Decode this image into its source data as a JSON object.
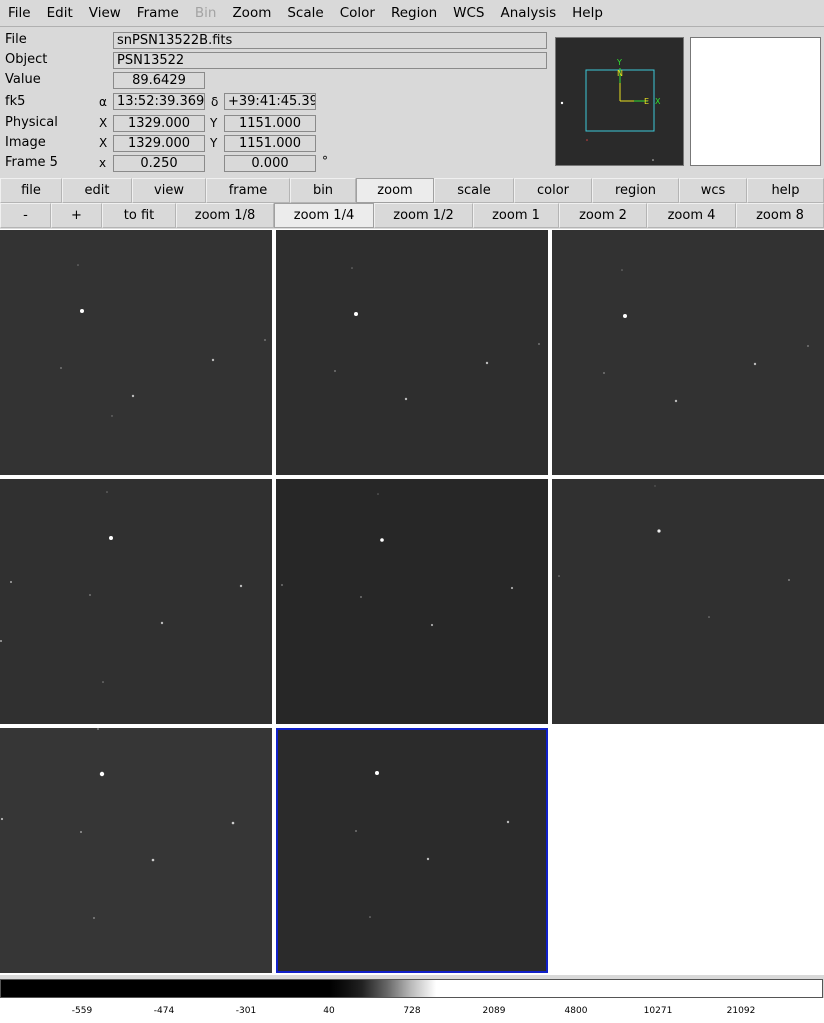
{
  "menu": [
    "File",
    "Edit",
    "View",
    "Frame",
    "Bin",
    "Zoom",
    "Scale",
    "Color",
    "Region",
    "WCS",
    "Analysis",
    "Help"
  ],
  "menu_disabled": [
    "Bin"
  ],
  "info": {
    "file_label": "File",
    "file_value": "snPSN13522B.fits",
    "object_label": "Object",
    "object_value": "PSN13522",
    "value_label": "Value",
    "value_value": "89.6429",
    "wcs_label": "fk5",
    "alpha_sym": "α",
    "alpha_value": "13:52:39.369",
    "delta_sym": "δ",
    "delta_value": "+39:41:45.39",
    "physical_label": "Physical",
    "physical_x_sym": "X",
    "physical_x": "1329.000",
    "physical_y_sym": "Y",
    "physical_y": "1151.000",
    "image_label": "Image",
    "image_x_sym": "X",
    "image_x": "1329.000",
    "image_y_sym": "Y",
    "image_y": "1151.000",
    "frame_label": "Frame 5",
    "frame_x_sym": "x",
    "frame_zoom": "0.250",
    "frame_angle": "0.000",
    "degree_sym": "°"
  },
  "magnifier": {
    "north": "N",
    "east": "E",
    "y": "Y",
    "x": "X"
  },
  "buttonbar": [
    "file",
    "edit",
    "view",
    "frame",
    "bin",
    "zoom",
    "scale",
    "color",
    "region",
    "wcs",
    "help"
  ],
  "buttonbar_active": "zoom",
  "zoombar": [
    "-",
    "+",
    "to fit",
    "zoom 1/8",
    "zoom 1/4",
    "zoom 1/2",
    "zoom 1",
    "zoom 2",
    "zoom 4",
    "zoom 8"
  ],
  "zoombar_active": "zoom 1/4",
  "frames": {
    "count": 8,
    "current": 8
  },
  "colorbar_ticks": [
    "-559",
    "-474",
    "-301",
    "40",
    "728",
    "2089",
    "4800",
    "10271",
    "21092"
  ]
}
